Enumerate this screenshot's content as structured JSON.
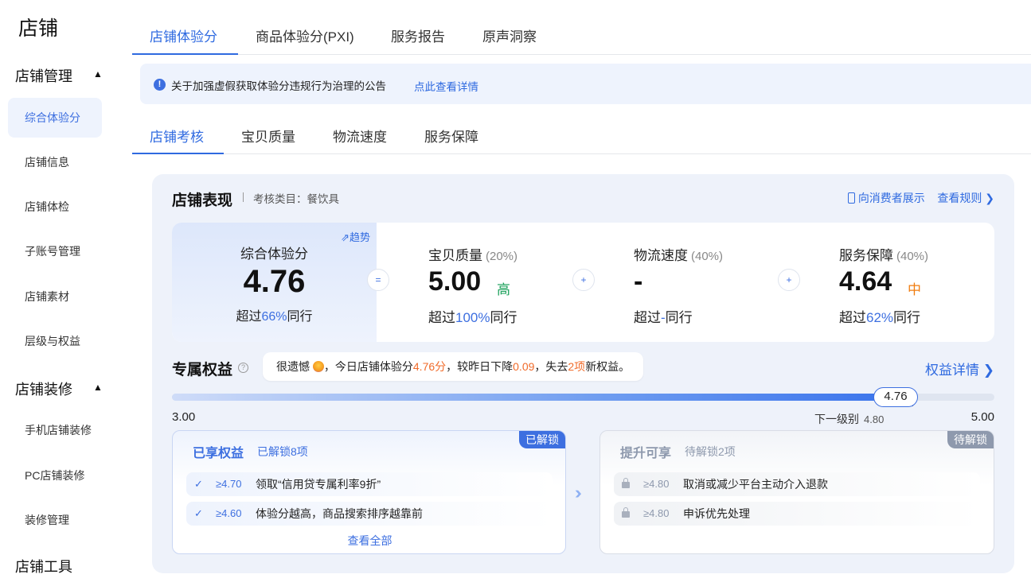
{
  "sidebar": {
    "title": "店铺",
    "groups": [
      {
        "label": "店铺管理"
      },
      {
        "label": "店铺装修"
      },
      {
        "label": "店铺工具"
      }
    ],
    "items": [
      {
        "label": "综合体验分"
      },
      {
        "label": "店铺信息"
      },
      {
        "label": "店铺体检"
      },
      {
        "label": "子账号管理"
      },
      {
        "label": "店铺素材"
      },
      {
        "label": "层级与权益"
      },
      {
        "label": "手机店铺装修"
      },
      {
        "label": "PC店铺装修"
      },
      {
        "label": "装修管理"
      }
    ]
  },
  "top_tabs": [
    "店铺体验分",
    "商品体验分(PXI)",
    "服务报告",
    "原声洞察"
  ],
  "notice": {
    "text": "关于加强虚假获取体验分违规行为治理的公告",
    "link": "点此查看详情"
  },
  "sub_tabs": [
    "店铺考核",
    "宝贝质量",
    "物流速度",
    "服务保障"
  ],
  "performance": {
    "title": "店铺表现",
    "category": "考核类目：餐饮具",
    "link_consumer": "向消费者展示",
    "link_rules": "查看规则",
    "trend": "趋势",
    "overall": {
      "label": "综合体验分",
      "value": "4.76",
      "sub_prefix": "超过",
      "sub_pct": "66%",
      "sub_suffix": "同行"
    },
    "op_eq": "=",
    "op_plus": "+",
    "metrics": [
      {
        "label": "宝贝质量",
        "weight": "(20%)",
        "value": "5.00",
        "level": "高",
        "sub_prefix": "超过",
        "sub_pct": "100%",
        "sub_suffix": "同行"
      },
      {
        "label": "物流速度",
        "weight": "(40%)",
        "value": "-",
        "level": "",
        "sub_prefix": "超过",
        "sub_pct": "-",
        "sub_suffix": "同行"
      },
      {
        "label": "服务保障",
        "weight": "(40%)",
        "value": "4.64",
        "level": "中",
        "sub_prefix": "超过",
        "sub_pct": "62%",
        "sub_suffix": "同行"
      }
    ]
  },
  "benefits": {
    "title": "专属权益",
    "bubble": {
      "p1": "很遗憾",
      "p2": "，今日店铺体验分",
      "score": "4.76分",
      "p3": "，较昨日下降",
      "drop": "0.09",
      "p4": "，失去",
      "lost": "2项",
      "p5": "新权益。"
    },
    "link": "权益详情",
    "progress": {
      "min": "3.00",
      "max": "5.00",
      "current": "4.76",
      "next_label": "下一级别",
      "next_value": "4.80",
      "min_value": 3.0,
      "max_value": 5.0,
      "current_value": 4.76,
      "next_level_value": 4.8
    },
    "unlocked": {
      "title": "已享权益",
      "count": "已解锁8项",
      "tag": "已解锁",
      "rows": [
        {
          "threshold": "≥4.70",
          "text": "领取“信用贷专属利率9折”"
        },
        {
          "threshold": "≥4.60",
          "text": "体验分越高，商品搜索排序越靠前"
        }
      ],
      "view_all": "查看全部"
    },
    "locked": {
      "title": "提升可享",
      "count": "待解锁2项",
      "tag": "待解锁",
      "rows": [
        {
          "threshold": "≥4.80",
          "text": "取消或减少平台主动介入退款"
        },
        {
          "threshold": "≥4.80",
          "text": "申诉优先处理"
        }
      ]
    }
  },
  "colors": {
    "accent": "#2f6ae0",
    "orange": "#f06b2a",
    "green": "#1aa05a",
    "panel_bg": "#eef2fa"
  }
}
